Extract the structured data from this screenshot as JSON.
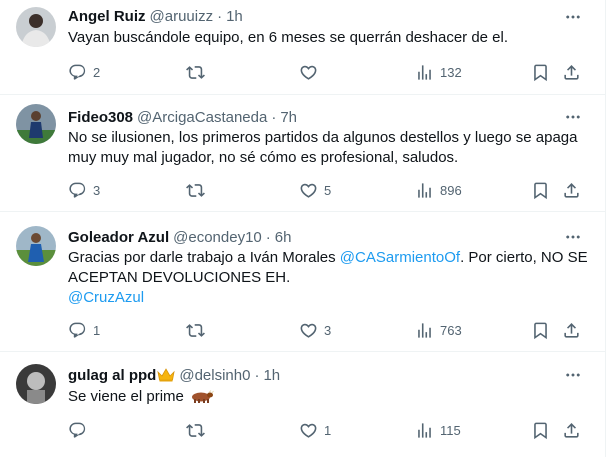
{
  "tweets": [
    {
      "name": "Angel Ruiz",
      "handle": "@aruuizz",
      "time": "1h",
      "text": "Vayan buscándole equipo, en 6 meses se querrán deshacer de el.",
      "replies": "2",
      "retweets": "",
      "likes": "",
      "views": "132"
    },
    {
      "name": "Fideo308",
      "handle": "@ArcigaCastaneda",
      "time": "7h",
      "text": "No se ilusionen, los primeros partidos da algunos destellos y luego se apaga muy muy mal jugador, no sé cómo es profesional, saludos.",
      "replies": "3",
      "retweets": "",
      "likes": "5",
      "views": "896"
    },
    {
      "name": "Goleador Azul",
      "handle": "@econdey10",
      "time": "6h",
      "text_part1": "Gracias por darle trabajo a Iván Morales ",
      "mention1": "@CASarmientoOf",
      "text_part2": ". Por cierto, NO SE ACEPTAN DEVOLUCIONES EH.",
      "mention2": "@CruzAzul",
      "replies": "1",
      "retweets": "",
      "likes": "3",
      "views": "763"
    },
    {
      "name": "gulag al ppd",
      "handle": "@delsinh0",
      "time": "1h",
      "text": "Se viene el prime",
      "replies": "",
      "retweets": "",
      "likes": "1",
      "views": "115"
    }
  ],
  "separator": "·",
  "icons": {
    "more": "more-dots-icon",
    "reply": "reply-icon",
    "retweet": "retweet-icon",
    "like": "heart-icon",
    "views": "views-chart-icon",
    "bookmark": "bookmark-icon",
    "share": "share-icon",
    "crown": "crown-emoji",
    "bull": "ox-emoji"
  },
  "colors": {
    "text": "#0f1419",
    "secondary": "#536471",
    "link": "#1d9bf0",
    "border": "#eff3f4"
  }
}
